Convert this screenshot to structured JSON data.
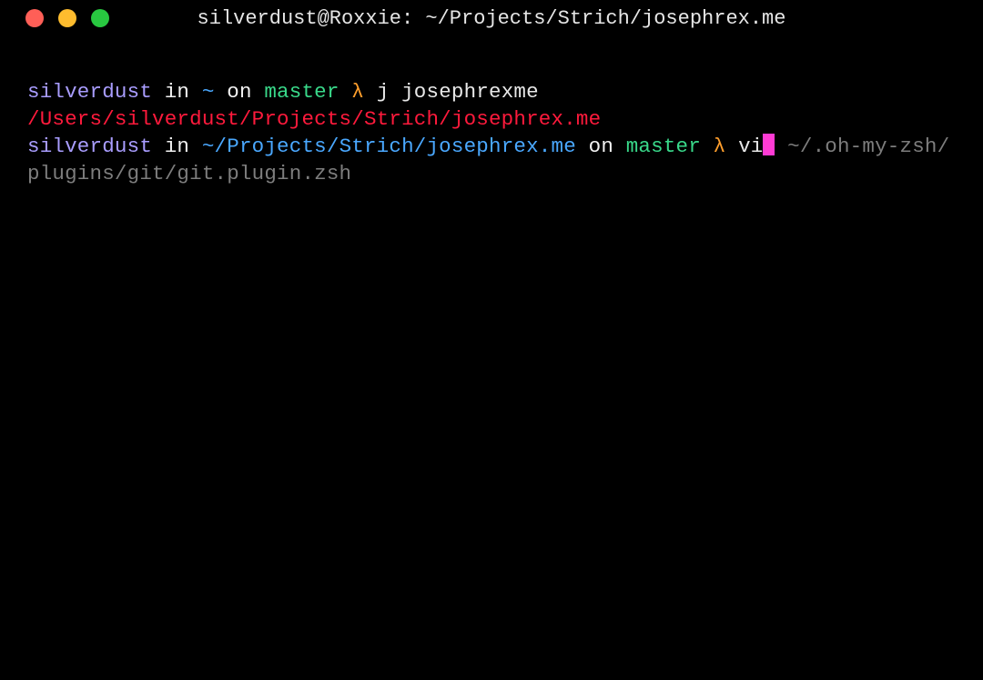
{
  "window": {
    "title": "silverdust@Roxxie: ~/Projects/Strich/josephrex.me"
  },
  "prompt1": {
    "user": "silverdust",
    "in": " in ",
    "path": "~",
    "on": " on ",
    "branch": "master",
    "lambda": " λ ",
    "command": "j josephrexme"
  },
  "output1": "/Users/silverdust/Projects/Strich/josephrex.me",
  "prompt2": {
    "user": "silverdust",
    "in": " in ",
    "path": "~/Projects/Strich/josephrex.me",
    "on": " on ",
    "branch": "master",
    "lambda": " λ ",
    "typed": "vi",
    "suggestion": " ~/.oh-my-zsh/plugins/git/git.plugin.zsh"
  }
}
